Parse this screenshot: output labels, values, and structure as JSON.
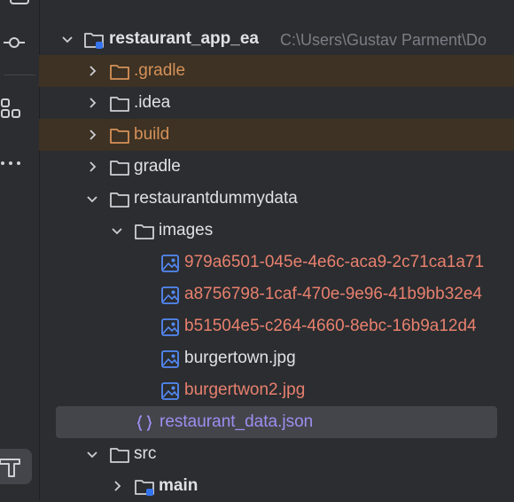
{
  "toolstrip": {
    "top_icon": "folder-icon",
    "commit_icon": "commit-icon",
    "structure_icon": "structure-icon",
    "more_icon": "more-icon",
    "build_icon": "build-hammer-icon"
  },
  "colors": {
    "bg": "#2b2d30",
    "ignored_row": "#3d3223",
    "selected_row": "#43454a",
    "text": "#dfe1e5",
    "ignored_text": "#d6915a",
    "modified_text": "#e8806e",
    "json_text": "#9b8ff0"
  },
  "tree": {
    "root": {
      "name": "restaurant_app_ea",
      "path": "C:\\Users\\Gustav Parment\\Do"
    },
    "items": [
      {
        "label": ".gradle"
      },
      {
        "label": ".idea"
      },
      {
        "label": "build"
      },
      {
        "label": "gradle"
      },
      {
        "label": "restaurantdummydata"
      },
      {
        "label": "images"
      },
      {
        "label": "979a6501-045e-4e6c-aca9-2c71ca1a71"
      },
      {
        "label": "a8756798-1caf-470e-9e96-41b9bb32e4"
      },
      {
        "label": "b51504e5-c264-4660-8ebc-16b9a12d4"
      },
      {
        "label": "burgertown.jpg"
      },
      {
        "label": "burgertwon2.jpg"
      },
      {
        "label": "restaurant_data.json"
      },
      {
        "label": "src"
      },
      {
        "label": "main"
      }
    ]
  }
}
